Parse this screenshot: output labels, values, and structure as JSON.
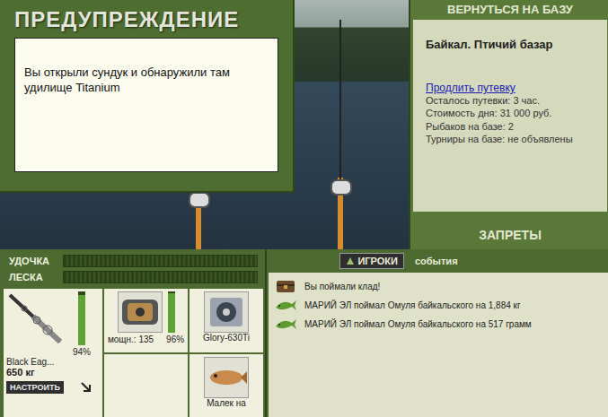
{
  "warning": {
    "title": "ПРЕДУПРЕЖДЕНИЕ",
    "message": "Вы открыли сундук и обнаружили там удилище Titanium"
  },
  "base": {
    "back_button": "ВЕРНУТЬСЯ НА БАЗУ",
    "name": "Байкал. Птичий базар",
    "extend_link": "Продлить путевку",
    "info": [
      "Осталось путевки: 3 час.",
      "Стоимость дня: 31 000 руб.",
      "Рыбаков на базе: 2",
      "Турниры на базе: не объявлены"
    ],
    "bans_button": "ЗАПРЕТЫ"
  },
  "meters": [
    {
      "label": "УДОЧКА",
      "level": 0
    },
    {
      "label": "ЛЕСКА",
      "level": 0
    }
  ],
  "tackle": {
    "rod": {
      "name": "Black Eag...",
      "load": "650 кг",
      "wear": "94%",
      "level": 0.94
    },
    "configure_button": "НАСТРОИТЬ",
    "reel": {
      "power": "мощн.: 135",
      "wear": "96%",
      "level": 0.96
    },
    "line": {
      "name": "Glory-630Ti"
    },
    "lure": {
      "name": "Малек на"
    }
  },
  "events_panel": {
    "tabs": [
      {
        "label": "ИГРОКИ",
        "selected": false
      },
      {
        "label": "события",
        "selected": true
      }
    ],
    "events": [
      {
        "kind": "treasure",
        "text": "Вы поймали клад!"
      },
      {
        "kind": "catch",
        "text": "МАРИЙ ЭЛ поймал Омуля байкальского на 1,884 кг"
      },
      {
        "kind": "catch",
        "text": "МАРИЙ ЭЛ поймал Омуля байкальского на 517 грамм"
      }
    ]
  }
}
